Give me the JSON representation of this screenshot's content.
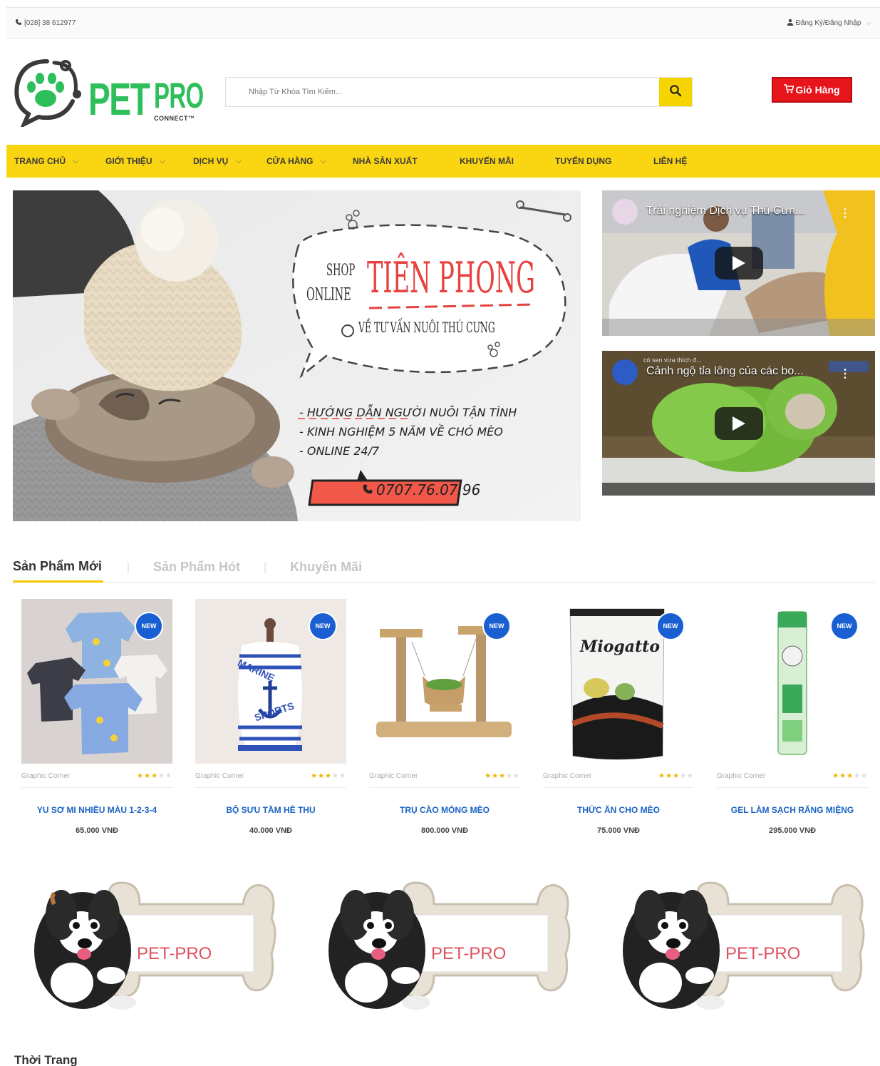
{
  "topbar": {
    "phone": "[028] 38 612977",
    "account": "Đăng Ký/Đăng Nhập"
  },
  "logo": {
    "brand_a": "PET",
    "brand_b": "PRO",
    "sub": "CONNECT™"
  },
  "search": {
    "placeholder": "Nhập Từ Khóa Tìm Kiếm..."
  },
  "cart": {
    "label": "Giỏ Hàng"
  },
  "nav": [
    {
      "label": "TRANG CHỦ"
    },
    {
      "label": "GIỚI THIỆU"
    },
    {
      "label": "DỊCH VỤ"
    },
    {
      "label": "CỬA HÀNG"
    },
    {
      "label": "NHÀ SẢN XUẤT"
    },
    {
      "label": "KHUYẾN MÃI"
    },
    {
      "label": "TUYỂN DỤNG"
    },
    {
      "label": "LIÊN HỆ"
    }
  ],
  "banner": {
    "shop": "SHOP",
    "online": "ONLINE",
    "headline": "TIÊN PHONG",
    "sub": "VỀ TƯ VẤN NUÔI THÚ CƯNG",
    "bullets": [
      "- HƯỚNG DẪN NGƯỜI NUÔI TẬN TÌNH",
      "- KINH NGHIỆM 5 NĂM VỀ CHÓ MÈO",
      "- ONLINE 24/7"
    ],
    "hotline": "0707.76.07.96"
  },
  "videos": [
    {
      "title": "Trải nghiệm Dịch vụ Thú Cưn..."
    },
    {
      "title": "Cảnh ngộ tỉa lông của các bo...",
      "overlay": "có sen vừa thích đ..."
    }
  ],
  "tabs": [
    "Sản Phẩm Mới",
    "Sản Phẩm Hót",
    "Khuyến Mãi"
  ],
  "products": [
    {
      "badge": "NEW",
      "brand": "Graphic Corner",
      "rating": 3,
      "name": "YU SƠ MI NHIỀU MÀU 1-2-3-4",
      "price": "65.000 VNĐ"
    },
    {
      "badge": "NEW",
      "brand": "Graphic Corner",
      "rating": 3,
      "name": "BỘ SƯU TẦM HÈ THU",
      "price": "40.000 VNĐ"
    },
    {
      "badge": "NEW",
      "brand": "Graphic Corner",
      "rating": 3,
      "name": "TRỤ CÀO MÓNG MÈO",
      "price": "800.000 VNĐ"
    },
    {
      "badge": "NEW",
      "brand": "Graphic Corner",
      "rating": 3,
      "name": "THỨC ĂN CHO MÈO",
      "price": "75.000 VNĐ"
    },
    {
      "badge": "NEW",
      "brand": "Graphic Corner",
      "rating": 3,
      "name": "GEL LÀM SẠCH RĂNG MIỆNG",
      "price": "295.000 VNĐ"
    }
  ],
  "product_art": {
    "p2_text_a": "MARINE",
    "p2_text_b": "SPORTS",
    "p4_brand": "Miogatto"
  },
  "promos": [
    {
      "label": "PET-PRO"
    },
    {
      "label": "PET-PRO"
    },
    {
      "label": "PET-PRO"
    }
  ],
  "section": {
    "title": "Thời Trang"
  },
  "colors": {
    "nav": "#f9d512",
    "cart": "#e8141c",
    "brand_green": "#2fbf5a",
    "product_link": "#1a63c4",
    "badge": "#1a5fd1"
  }
}
